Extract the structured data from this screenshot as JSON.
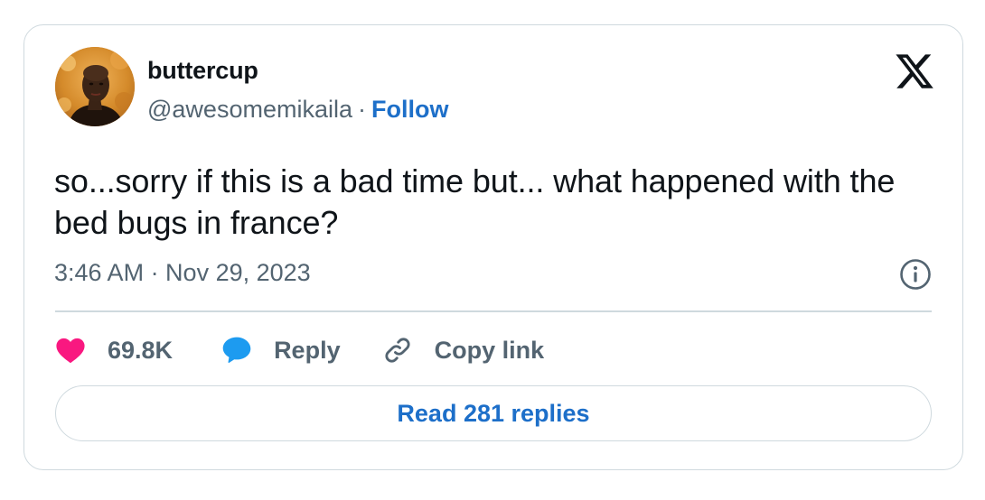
{
  "author": {
    "display_name": "buttercup",
    "handle": "@awesomemikaila",
    "separator": "·",
    "follow_label": "Follow"
  },
  "tweet": {
    "text": "so...sorry if this is a bad time but... what happened with the bed bugs in france?",
    "timestamp": "3:46 AM · Nov 29, 2023"
  },
  "actions": {
    "likes_count": "69.8K",
    "reply_label": "Reply",
    "copy_link_label": "Copy link"
  },
  "read_replies_label": "Read 281 replies",
  "icons": {
    "platform": "x-logo-icon",
    "info": "info-icon",
    "like": "heart-icon",
    "reply": "speech-bubble-icon",
    "copy": "link-icon"
  },
  "colors": {
    "text_primary": "#0f1419",
    "text_secondary": "#536471",
    "link_blue": "#1d6fc9",
    "like_pink": "#f91880",
    "reply_blue": "#1d9bf0",
    "border": "#cfd9de"
  }
}
